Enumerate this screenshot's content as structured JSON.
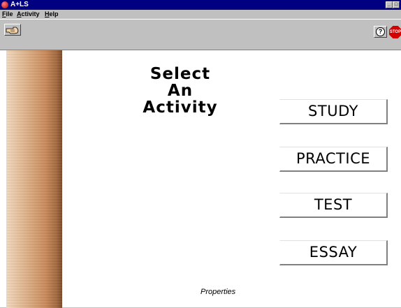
{
  "window": {
    "title": "A+LS",
    "app_icon": "apple-icon",
    "controls": [
      "minimize",
      "maximize"
    ]
  },
  "menu": {
    "items": [
      {
        "label": "File",
        "underline": "F"
      },
      {
        "label": "Activity",
        "underline": "A"
      },
      {
        "label": "Help",
        "underline": "H"
      }
    ]
  },
  "toolbar": {
    "left_icon": "pointing-hand-icon",
    "help_glyph": "?",
    "stop_text": "STOP"
  },
  "main": {
    "heading_lines": [
      "Select",
      "An",
      "Activity"
    ],
    "activities": [
      {
        "label": "STUDY"
      },
      {
        "label": "PRACTICE"
      },
      {
        "label": "TEST"
      },
      {
        "label": "ESSAY"
      }
    ],
    "properties_label": "Properties"
  },
  "colors": {
    "titlebar": "#000080",
    "chrome": "#c0c0c0",
    "stop": "#d40000",
    "wood": "#c98a5c"
  }
}
